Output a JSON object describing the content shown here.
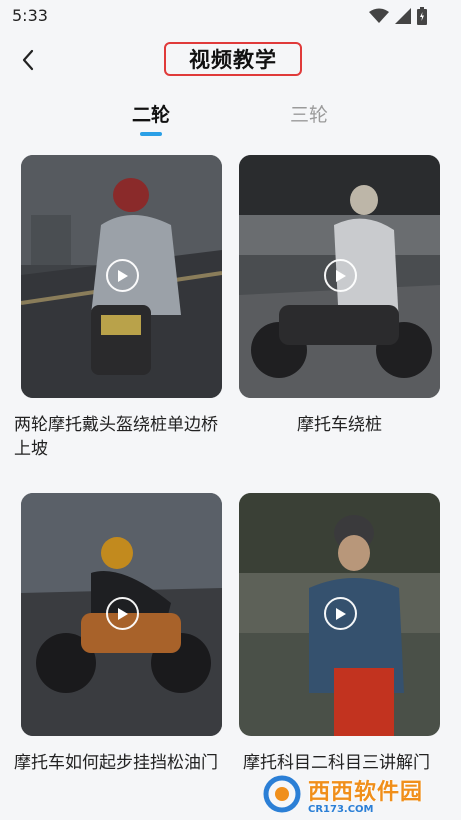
{
  "status_bar": {
    "time": "5:33",
    "icons": [
      "wifi-icon",
      "signal-icon",
      "battery-icon"
    ]
  },
  "header": {
    "back_icon": "chevron-left-icon",
    "title": "视频教学"
  },
  "tabs": [
    {
      "label": "二轮",
      "selected": true
    },
    {
      "label": "三轮",
      "selected": false
    }
  ],
  "videos": [
    {
      "title": "两轮摩托戴头盔绕桩单边桥上坡",
      "play_icon": "play-icon"
    },
    {
      "title": "摩托车绕桩",
      "play_icon": "play-icon"
    },
    {
      "title": "摩托车如何起步挂挡松油门",
      "play_icon": "play-icon"
    },
    {
      "title": "摩托科目二科目三讲解门",
      "play_icon": "play-icon"
    }
  ],
  "watermark": {
    "brand": "西西软件园",
    "sub": "CR173.COM"
  },
  "colors": {
    "accent": "#2a9fe6",
    "title_border": "#e03a3a",
    "inactive_tab": "#9a9a9a"
  }
}
